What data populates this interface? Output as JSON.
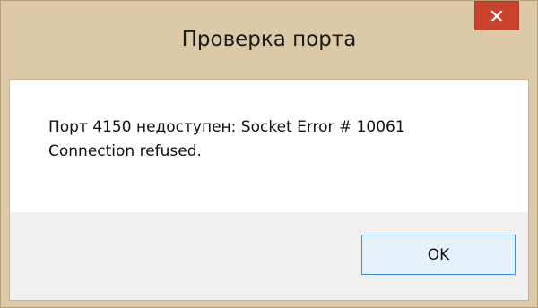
{
  "window": {
    "title": "Проверка порта",
    "close_icon": "close-icon",
    "accent_color": "#c9432c"
  },
  "message": {
    "line1": "Порт 4150 недоступен: Socket Error # 10061",
    "line2": "Connection refused."
  },
  "buttons": {
    "ok_label": "OK"
  }
}
